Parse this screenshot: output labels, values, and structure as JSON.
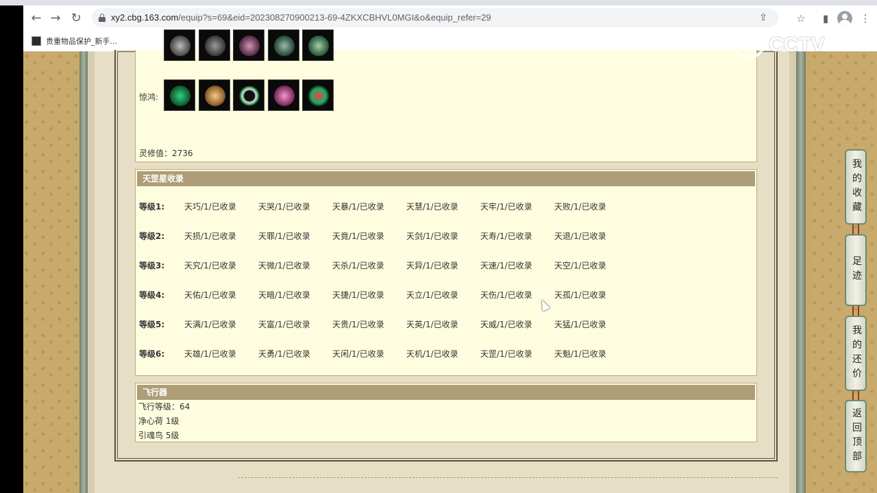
{
  "browser": {
    "url_host": "xy2.cbg.163.com",
    "url_path": "/equip?s=69&eid=202308270900213-69-4ZKXCBHVL0MGI&o&equip_refer=29",
    "bookmark_label": "贵重物品保护_新手..."
  },
  "watermark": {
    "text": "CCTV"
  },
  "top_section": {
    "row2_label": "惊鸿:",
    "lingxiu": "灵修值：2736"
  },
  "star_section": {
    "title": "天罡星收录",
    "rows": [
      {
        "level": "等级1:",
        "cells": [
          "天巧/1/已收录",
          "天哭/1/已收录",
          "天暴/1/已收录",
          "天慧/1/已收录",
          "天牢/1/已收录",
          "天败/1/已收录"
        ]
      },
      {
        "level": "等级2:",
        "cells": [
          "天损/1/已收录",
          "天罪/1/已收录",
          "天竟/1/已收录",
          "天剑/1/已收录",
          "天寿/1/已收录",
          "天退/1/已收录"
        ]
      },
      {
        "level": "等级3:",
        "cells": [
          "天究/1/已收录",
          "天微/1/已收录",
          "天杀/1/已收录",
          "天异/1/已收录",
          "天速/1/已收录",
          "天空/1/已收录"
        ]
      },
      {
        "level": "等级4:",
        "cells": [
          "天佑/1/已收录",
          "天暗/1/已收录",
          "天捷/1/已收录",
          "天立/1/已收录",
          "天伤/1/已收录",
          "天孤/1/已收录"
        ]
      },
      {
        "level": "等级5:",
        "cells": [
          "天满/1/已收录",
          "天富/1/已收录",
          "天贵/1/已收录",
          "天英/1/已收录",
          "天威/1/已收录",
          "天猛/1/已收录"
        ]
      },
      {
        "level": "等级6:",
        "cells": [
          "天雄/1/已收录",
          "天勇/1/已收录",
          "天闲/1/已收录",
          "天机/1/已收录",
          "天罡/1/已收录",
          "天魁/1/已收录"
        ]
      }
    ]
  },
  "fly_section": {
    "title": "飞行器",
    "lines": [
      "飞行等级：64",
      "净心荷   1级",
      "引魂鸟   5级"
    ]
  },
  "floatnav": [
    {
      "text": "我的收藏"
    },
    {
      "text": "足迹"
    },
    {
      "text": "我的还价"
    },
    {
      "text": "返回顶部"
    }
  ]
}
